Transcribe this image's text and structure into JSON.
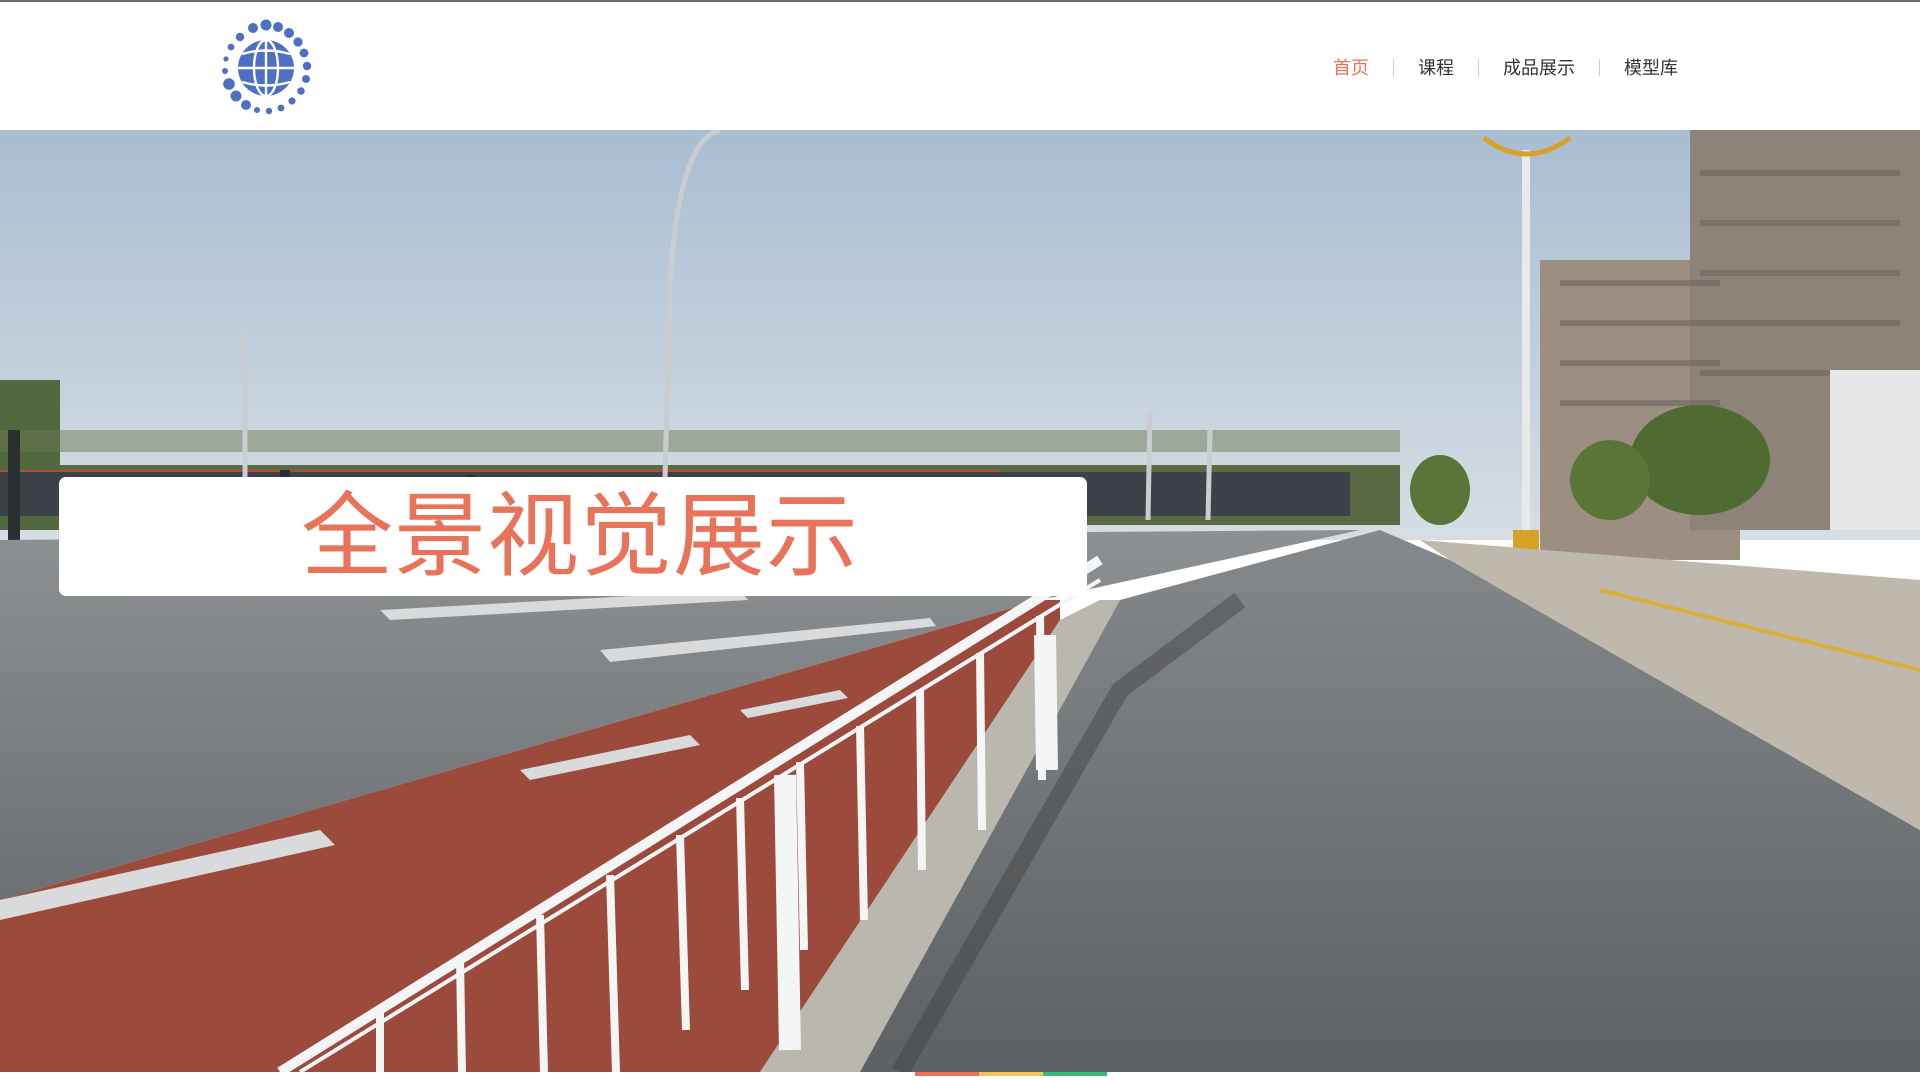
{
  "nav": {
    "items": [
      {
        "label": "首页",
        "active": true
      },
      {
        "label": "课程",
        "active": false
      },
      {
        "label": "成品展示",
        "active": false
      },
      {
        "label": "模型库",
        "active": false
      }
    ]
  },
  "hero": {
    "title": "全景视觉展示",
    "background": "panoramic-street-photo"
  },
  "logo": {
    "icon": "globe-dots-logo"
  },
  "colors": {
    "accent": "#e8735a",
    "logo": "#4d6fc4",
    "indicator_1": "#e8735a",
    "indicator_2": "#f2c45c",
    "indicator_3": "#3cb879"
  },
  "slider": {
    "slide_count": 3
  }
}
